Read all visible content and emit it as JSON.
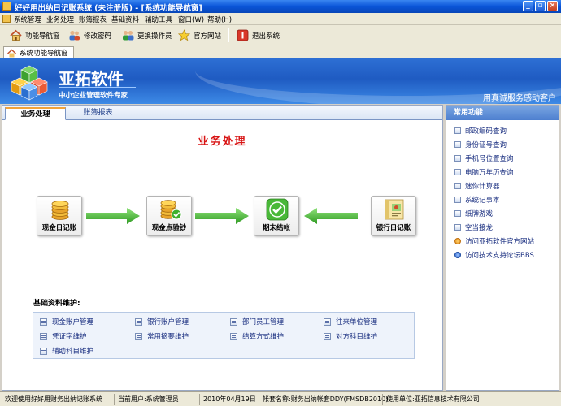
{
  "window": {
    "title": "好好用出纳日记账系统 (未注册版) - [系统功能导航窗]",
    "minimize_glyph": "_",
    "restore_glyph": "▫",
    "close_glyph": "×"
  },
  "menu": [
    {
      "label": "系统管理"
    },
    {
      "label": "业务处理"
    },
    {
      "label": "账簿报表"
    },
    {
      "label": "基础资料"
    },
    {
      "label": "辅助工具"
    },
    {
      "label": "窗口(W)"
    },
    {
      "label": "帮助(H)"
    }
  ],
  "toolbar": {
    "nav_label": "功能导航窗",
    "password_label": "修改密码",
    "operator_label": "更换操作员",
    "website_label": "官方网站",
    "exit_label": "退出系统"
  },
  "doc_tab": {
    "label": "系统功能导航窗"
  },
  "banner": {
    "brand": "亚拓软件",
    "tagline": "中小企业管理软件专家",
    "slogan": "用真诚服务感动客户"
  },
  "main": {
    "tabs": [
      {
        "label": "业务处理",
        "active": true
      },
      {
        "label": "账簿报表",
        "active": false
      }
    ],
    "section_title": "业务处理",
    "flow": [
      {
        "label": "现金日记账"
      },
      {
        "label": "现金点验钞"
      },
      {
        "label": "期末结帐"
      },
      {
        "label": "银行日记账"
      }
    ],
    "maintenance": {
      "title": "基础资料维护:",
      "links": [
        "现金账户管理",
        "银行账户管理",
        "部门员工管理",
        "往来单位管理",
        "凭证字维护",
        "常用摘要维护",
        "结算方式维护",
        "对方科目维护",
        "辅助科目维护"
      ]
    }
  },
  "common": {
    "title": "常用功能",
    "items": [
      {
        "label": "邮政编码查询",
        "icon": "doc-icon"
      },
      {
        "label": "身份证号查询",
        "icon": "doc-icon"
      },
      {
        "label": "手机号位置查询",
        "icon": "doc-icon"
      },
      {
        "label": "电脑万年历查询",
        "icon": "doc-icon"
      },
      {
        "label": "迷你计算器",
        "icon": "doc-icon"
      },
      {
        "label": "系统记事本",
        "icon": "doc-icon"
      },
      {
        "label": "纸牌游戏",
        "icon": "doc-icon"
      },
      {
        "label": "空当接龙",
        "icon": "doc-icon"
      },
      {
        "label": "访问亚拓软件官方网站",
        "icon": "web-icon"
      },
      {
        "label": "访问技术支持论坛BBS",
        "icon": "bbs-icon"
      }
    ]
  },
  "status": {
    "welcome": "欢迎使用好好用财务出纳记账系统",
    "user": "当前用户:系统管理员",
    "date": "2010年04月19日",
    "account_set": "帐套名称:财务出纳帐套DDY(FMSDB2010)",
    "company": "使用单位:亚拓信息技术有限公司"
  },
  "colors": {
    "title_blue": "#0a55d8",
    "banner_blue": "#2d6fd4",
    "section_red": "#d81414",
    "arrow_green": "#3db52c",
    "link_blue": "#1a2f80"
  }
}
